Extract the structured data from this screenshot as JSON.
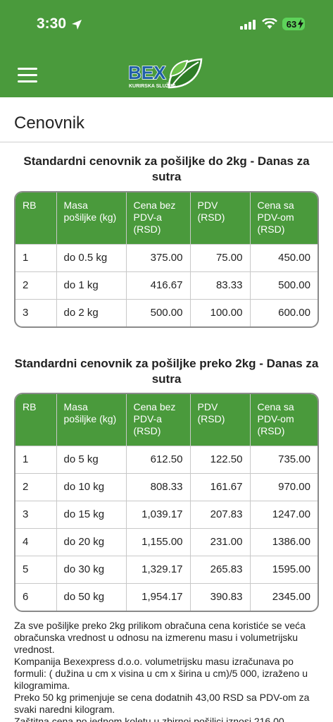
{
  "status": {
    "time": "3:30",
    "battery": "63"
  },
  "header": {
    "logo_text": "BEX",
    "logo_sub": "KURIRSKA SLUŽBA"
  },
  "page": {
    "title": "Cenovnik"
  },
  "columns": [
    "RB",
    "Masa pošiljke (kg)",
    "Cena bez PDV-a (RSD)",
    "PDV (RSD)",
    "Cena sa PDV-om (RSD)"
  ],
  "table1": {
    "title": "Standardni cenovnik za pošiljke do 2kg - Danas za sutra",
    "rows": [
      [
        "1",
        "do 0.5 kg",
        "375.00",
        "75.00",
        "450.00"
      ],
      [
        "2",
        "do 1 kg",
        "416.67",
        "83.33",
        "500.00"
      ],
      [
        "3",
        "do 2 kg",
        "500.00",
        "100.00",
        "600.00"
      ]
    ]
  },
  "table2": {
    "title": "Standardni cenovnik za pošiljke preko 2kg - Danas za sutra",
    "rows": [
      [
        "1",
        "do 5 kg",
        "612.50",
        "122.50",
        "735.00"
      ],
      [
        "2",
        "do 10 kg",
        "808.33",
        "161.67",
        "970.00"
      ],
      [
        "3",
        "do 15 kg",
        "1,039.17",
        "207.83",
        "1247.00"
      ],
      [
        "4",
        "do 20 kg",
        "1,155.00",
        "231.00",
        "1386.00"
      ],
      [
        "5",
        "do 30 kg",
        "1,329.17",
        "265.83",
        "1595.00"
      ],
      [
        "6",
        "do 50 kg",
        "1,954.17",
        "390.83",
        "2345.00"
      ]
    ]
  },
  "notes": [
    "Za sve pošiljke preko 2kg prilikom obračuna cena koristiće se veća obračunska vrednost u odnosu na izmerenu masu i volumetrijsku vrednost.",
    "Kompanija Bexexpress d.o.o. volumetrijsku masu izračunava po formuli: ( dužina u cm x visina u cm x širina u cm)/5 000, izraženo u kilogramima.",
    "Preko 50 kg primenjuje se cena dodatnih 43,00 RSD sa PDV-om za svaki naredni kilogram.",
    "Zaštitna cena po jednom koletu u zbirnoj pošiljci iznosi 216,00"
  ],
  "colors": {
    "brand_green": "#4a9a3c",
    "logo_blue": "#1f5fa8"
  }
}
